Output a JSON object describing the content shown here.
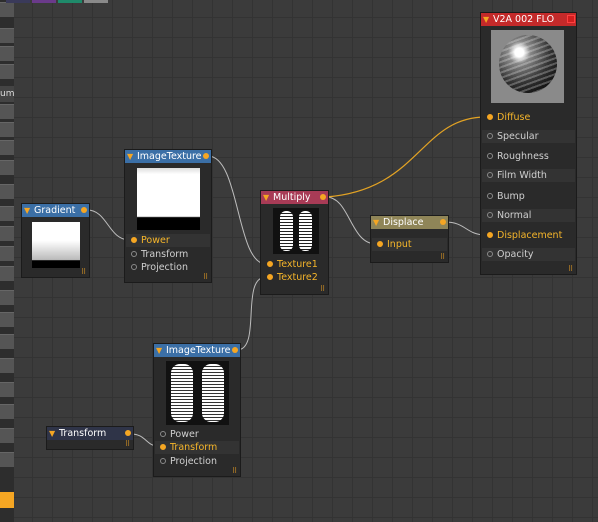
{
  "left_strip": {
    "cropped_label": "um"
  },
  "nodes": {
    "gradient": {
      "title": "Gradient"
    },
    "image_texture_1": {
      "title": "ImageTexture",
      "ports": [
        "Power",
        "Transform",
        "Projection"
      ]
    },
    "multiply": {
      "title": "Multiply",
      "ports": [
        "Texture1",
        "Texture2"
      ]
    },
    "displace": {
      "title": "Displace",
      "ports": [
        "Input"
      ]
    },
    "material": {
      "title": "V2A 002 FLO",
      "ports": [
        "Diffuse",
        "Specular",
        "Roughness",
        "Film Width",
        "Bump",
        "Normal",
        "Displacement",
        "Opacity"
      ]
    },
    "image_texture_2": {
      "title": "ImageTexture",
      "ports": [
        "Power",
        "Transform",
        "Projection"
      ]
    },
    "transform": {
      "title": "Transform"
    }
  },
  "colors": {
    "header_blue": "#3b6fa6",
    "header_multiply": "#a83b56",
    "header_displace": "#8f8558",
    "header_material": "#c42a2a",
    "wire": "#bdbdbd",
    "wire_active": "#e3a324"
  }
}
